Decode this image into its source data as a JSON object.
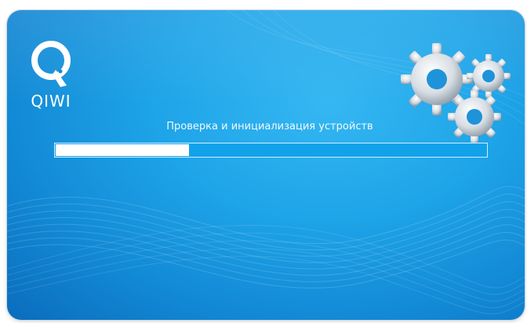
{
  "brand": {
    "name": "QIWI",
    "logo_icon": "qiwi-logo-icon"
  },
  "status": {
    "message": "Проверка и инициализация устройств"
  },
  "progress": {
    "fraction": 0.31
  },
  "decoration": {
    "gears_icon": "gears-icon"
  },
  "colors": {
    "background_light": "#35b7f2",
    "background_dark": "#0a6cbc",
    "progress_track": "#12a2ea",
    "progress_fill": "#ffffff",
    "text": "#f2f9ff"
  }
}
